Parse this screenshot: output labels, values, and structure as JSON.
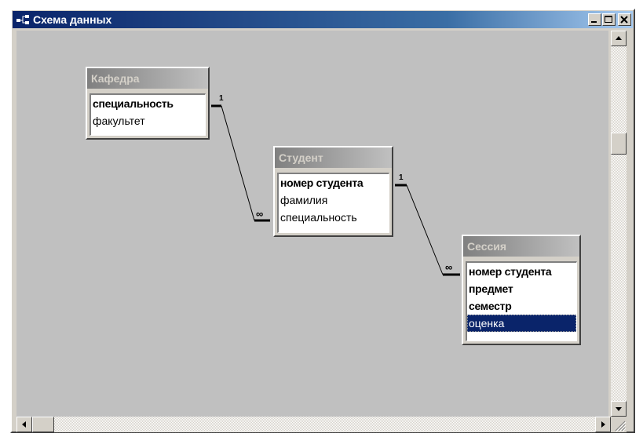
{
  "window": {
    "title": "Схема данных",
    "title_icon": "relationships-icon",
    "buttons": [
      "minimize-icon",
      "maximize-icon",
      "close-icon"
    ]
  },
  "tables": [
    {
      "name": "Кафедра",
      "fields": [
        {
          "label": "специальность",
          "key": true
        },
        {
          "label": "факультет",
          "key": false
        }
      ]
    },
    {
      "name": "Студент",
      "fields": [
        {
          "label": "номер студента",
          "key": true
        },
        {
          "label": "фамилия",
          "key": false
        },
        {
          "label": "специальность",
          "key": false
        }
      ]
    },
    {
      "name": "Сессия",
      "fields": [
        {
          "label": "номер студента",
          "key": true
        },
        {
          "label": "предмет",
          "key": true
        },
        {
          "label": "семестр",
          "key": true
        },
        {
          "label": "оценка",
          "key": false,
          "selected": true
        }
      ]
    }
  ],
  "relationships": [
    {
      "from": "Кафедра.специальность",
      "to": "Студент.специальность",
      "one": "1",
      "many": "∞"
    },
    {
      "from": "Студент.номер студента",
      "to": "Сессия.номер студента",
      "one": "1",
      "many": "∞"
    }
  ],
  "colors": {
    "title_active": "#0a246a",
    "table_title_inactive": "#808080",
    "selection": "#0a246a",
    "client_bg": "#c0c0c0"
  }
}
